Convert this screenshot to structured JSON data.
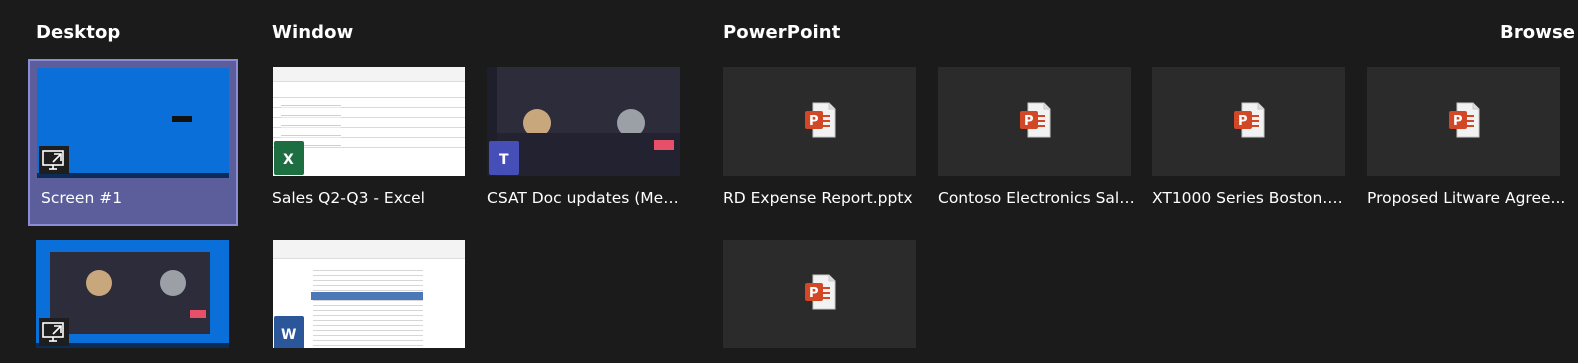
{
  "sections": {
    "desktop": "Desktop",
    "window": "Window",
    "powerpoint": "PowerPoint",
    "browse": "Browse"
  },
  "desktop_items": [
    {
      "label": "Screen #1",
      "selected": true,
      "icon": "cast-screen-icon"
    },
    {
      "label": "",
      "selected": false,
      "icon": "cast-screen-icon"
    }
  ],
  "window_items": [
    {
      "label": "Sales Q2-Q3 - Excel",
      "app_icon": "excel-icon",
      "badge_letter": "X"
    },
    {
      "label": "CSAT Doc updates (Meeti...",
      "app_icon": "teams-icon",
      "badge_letter": "T"
    },
    {
      "label": "",
      "app_icon": "word-icon",
      "badge_letter": "W"
    }
  ],
  "powerpoint_items": [
    {
      "label": "RD Expense Report.pptx",
      "icon": "powerpoint-file-icon"
    },
    {
      "label": "Contoso Electronics Sales...",
      "icon": "powerpoint-file-icon"
    },
    {
      "label": "XT1000 Series Boston.pptx",
      "icon": "powerpoint-file-icon"
    },
    {
      "label": "Proposed Litware Agree...",
      "icon": "powerpoint-file-icon"
    },
    {
      "label": "",
      "icon": "powerpoint-file-icon"
    }
  ],
  "colors": {
    "background": "#1b1b1b",
    "selected_tile": "#5b5e9b",
    "excel": "#1d6f42",
    "teams": "#464eb8",
    "word": "#2b579a",
    "powerpoint": "#d24726"
  }
}
